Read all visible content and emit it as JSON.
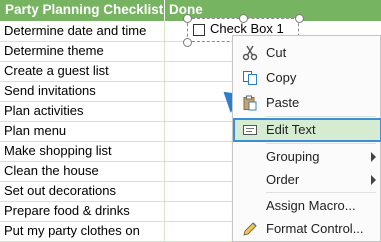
{
  "sheet": {
    "header_task": "Party Planning Checklist",
    "header_done": "Done",
    "tasks": [
      "Determine date and time",
      "Determine theme",
      "Create a guest list",
      "Send invitations",
      "Plan activities",
      "Plan menu",
      "Make shopping list",
      "Clean the house",
      "Set out decorations",
      "Prepare food & drinks",
      "Put my party clothes on"
    ],
    "header_color": "#77b461",
    "grid_color": "#d4e6c8"
  },
  "checkbox": {
    "label": "Check Box 1",
    "checked": false
  },
  "context_menu": {
    "items": [
      {
        "label": "Cut",
        "icon": "scissors-icon"
      },
      {
        "label": "Copy",
        "icon": "copy-icon"
      },
      {
        "label": "Paste",
        "icon": "paste-icon"
      },
      {
        "label": "Edit Text",
        "icon": "edit-text-icon",
        "selected": true
      },
      {
        "label": "Grouping",
        "submenu": true
      },
      {
        "label": "Order",
        "submenu": true
      },
      {
        "label": "Assign Macro..."
      },
      {
        "label": "Format Control...",
        "icon": "format-control-icon"
      }
    ],
    "highlight_color": "#d5ecd2",
    "border_color": "#3a8fd6"
  }
}
